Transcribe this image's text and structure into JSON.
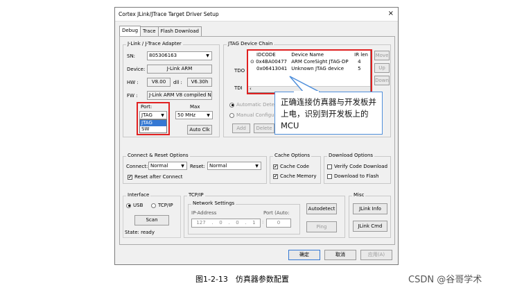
{
  "window": {
    "title": "Cortex JLink/JTrace Target Driver Setup",
    "close": "×"
  },
  "tabs": [
    "Debug",
    "Trace",
    "Flash Download"
  ],
  "jlink": {
    "legend": "J-Link / J-Trace Adapter",
    "sn_label": "SN:",
    "sn_value": "805306163",
    "device_label": "Device:",
    "device_value": "J-Link ARM",
    "hw_label": "HW :",
    "hw_value": "V8.00",
    "dll_label": "dll :",
    "dll_value": "V6.30h",
    "fw_label": "FW :",
    "fw_value": "J-Link ARM V8 compiled No",
    "port_label": "Port:",
    "port_value": "JTAG",
    "port_options": [
      "JTAG",
      "SW"
    ],
    "max_label": "Max",
    "max_value": "50 MHz",
    "autoclk": "Auto Clk"
  },
  "jtag": {
    "legend": "JTAG Device Chain",
    "tdo": "TDO",
    "tdi": "TDI",
    "headers": [
      "IDCODE",
      "Device Name",
      "IR len"
    ],
    "rows": [
      {
        "idcode": "0x4BA00477",
        "name": "ARM CoreSight JTAG-DP",
        "ir": "4"
      },
      {
        "idcode": "0x06413041",
        "name": "Unknown JTAG device",
        "ir": "5"
      }
    ],
    "move": "Move",
    "up": "Up",
    "down": "Down",
    "auto_detect": "Automatic Detection",
    "manual_config": "Manual Configurati",
    "add": "Add",
    "delete": "Delete"
  },
  "callout": {
    "text": "正确连接仿真器与开发板并上电，识别到开发板上的MCU"
  },
  "connect": {
    "legend": "Connect & Reset Options",
    "connect_label": "Connect:",
    "connect_value": "Normal",
    "reset_label": "Reset:",
    "reset_value": "Normal",
    "reset_after": "Reset after Connect"
  },
  "cache": {
    "legend": "Cache Options",
    "code": "Cache Code",
    "memory": "Cache Memory"
  },
  "download": {
    "legend": "Download Options",
    "verify": "Verify Code Download",
    "flash": "Download to Flash"
  },
  "iface": {
    "legend": "Interface",
    "usb": "USB",
    "tcpip": "TCP/IP",
    "scan": "Scan",
    "state": "State: ready"
  },
  "tcpip": {
    "legend": "TCP/IP",
    "network": "Network Settings",
    "ip_label": "IP-Address",
    "ip": [
      "127",
      "0",
      "0",
      "1"
    ],
    "port_label": "Port (Auto:",
    "port_value": "0",
    "autodetect": "Autodetect",
    "ping": "Ping"
  },
  "misc": {
    "legend": "Misc",
    "jlink_info": "JLink Info",
    "jlink_cmd": "JLink Cmd"
  },
  "footer": {
    "ok": "确定",
    "cancel": "取消",
    "apply": "应用(A)"
  },
  "caption": "图1-2-13　仿真器参数配置",
  "watermark": "CSDN @谷哥学术"
}
